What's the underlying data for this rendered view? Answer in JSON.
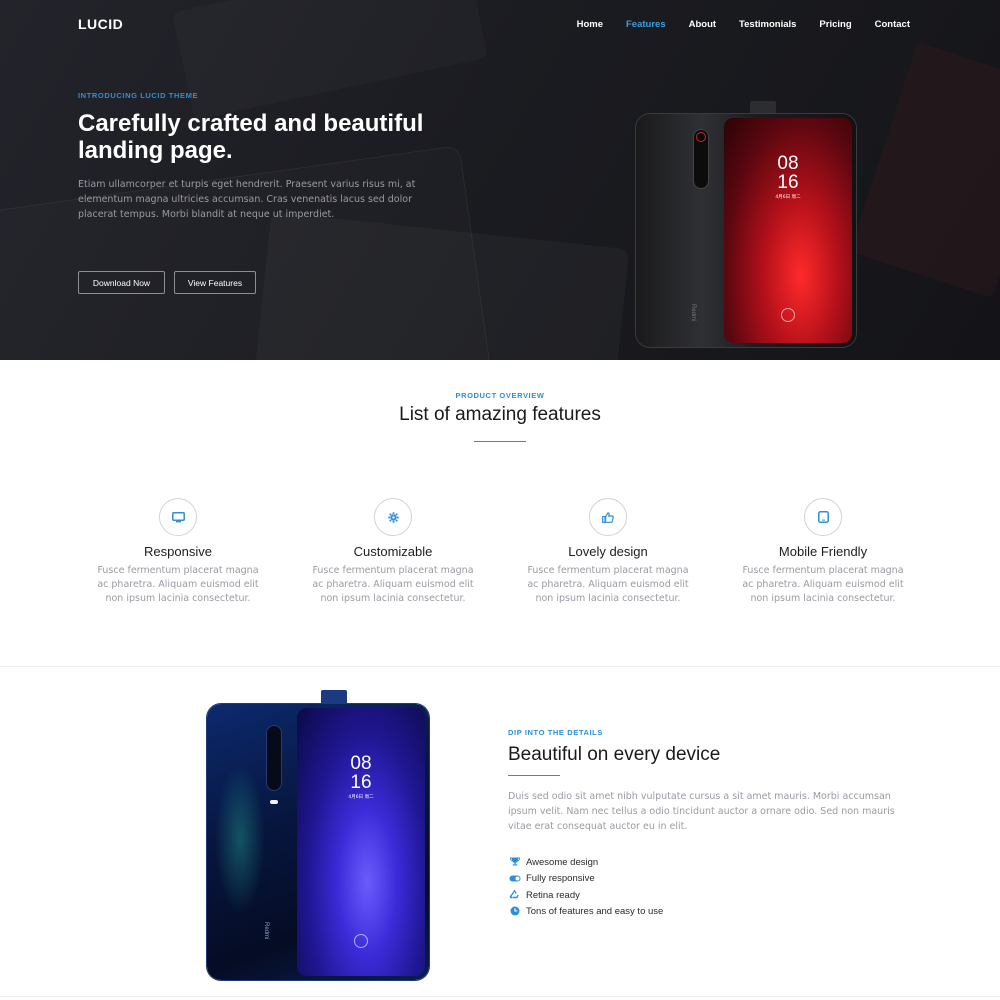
{
  "nav": {
    "logo": "LUCID",
    "items": [
      "Home",
      "Features",
      "About",
      "Testimonials",
      "Pricing",
      "Contact"
    ],
    "active": "Features"
  },
  "hero": {
    "eyebrow": "INTRODUCING LUCID THEME",
    "title": "Carefully crafted and beautiful landing page.",
    "lead": "Etiam ullamcorper et turpis eget hendrerit. Praesent varius risus mi, at elementum magna ultricies accumsan. Cras venenatis lacus sed dolor placerat tempus. Morbi blandit at neque ut imperdiet.",
    "primary_button": "Download Now",
    "secondary_button": "View Features",
    "phone": {
      "time_hours": "08",
      "time_minutes": "16",
      "date": "4月6日 周二",
      "brand": "Redmi"
    }
  },
  "overview": {
    "eyebrow": "PRODUCT OVERVIEW",
    "title": "List of amazing features",
    "features": [
      {
        "icon": "monitor-icon",
        "title": "Responsive",
        "text": "Fusce fermentum placerat magna ac pharetra. Aliquam euismod elit non ipsum lacinia consectetur."
      },
      {
        "icon": "gear-icon",
        "title": "Customizable",
        "text": "Fusce fermentum placerat magna ac pharetra. Aliquam euismod elit non ipsum lacinia consectetur."
      },
      {
        "icon": "thumbs-up-icon",
        "title": "Lovely design",
        "text": "Fusce fermentum placerat magna ac pharetra. Aliquam euismod elit non ipsum lacinia consectetur."
      },
      {
        "icon": "tablet-icon",
        "title": "Mobile Friendly",
        "text": "Fusce fermentum placerat magna ac pharetra. Aliquam euismod elit non ipsum lacinia consectetur."
      }
    ]
  },
  "details": {
    "eyebrow": "DIP INTO THE DETAILS",
    "title": "Beautiful on every device",
    "description": "Duis sed odio sit amet nibh vulputate cursus a sit amet mauris. Morbi accumsan ipsum velit. Nam nec tellus a odio tincidunt auctor a ornare odio. Sed non mauris vitae erat consequat auctor eu in elit.",
    "list": [
      {
        "icon": "trophy-icon",
        "text": "Awesome design"
      },
      {
        "icon": "toggle-icon",
        "text": "Fully responsive"
      },
      {
        "icon": "recycle-icon",
        "text": "Retina ready"
      },
      {
        "icon": "clock-icon",
        "text": "Tons of features and easy to use"
      }
    ],
    "phone": {
      "time_hours": "08",
      "time_minutes": "16",
      "date": "4月6日 周二",
      "brand": "Redmi"
    }
  },
  "colors": {
    "accent": "#2f8fd4",
    "hero_bg": "#1b1c21",
    "muted_text": "#9a9ba2"
  }
}
